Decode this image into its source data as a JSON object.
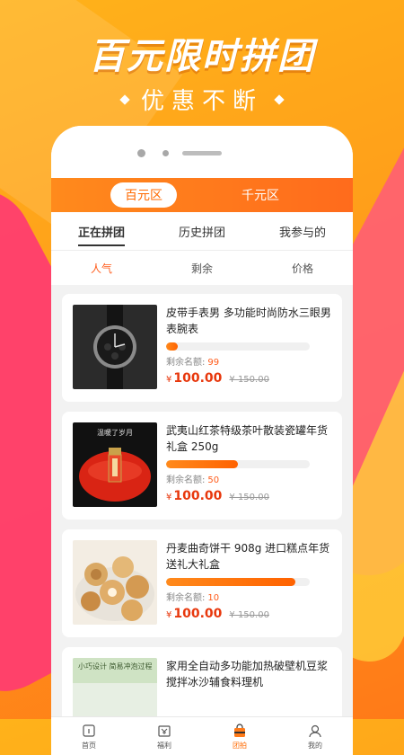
{
  "headline": "百元限时拼团",
  "subline": "优惠不断",
  "zones": [
    "百元区",
    "千元区"
  ],
  "tabs": [
    "正在拼团",
    "历史拼团",
    "我参与的"
  ],
  "sorts": [
    "人气",
    "剩余",
    "价格"
  ],
  "remain_label": "剩余名额:",
  "products": [
    {
      "title": "皮带手表男 多功能时尚防水三眼男表腕表",
      "remain": "99",
      "price": "100.00",
      "old_price": "¥ 150.00",
      "progress": 0.08
    },
    {
      "title": "武夷山红茶特级茶叶散装瓷罐年货礼盒 250g",
      "remain": "50",
      "price": "100.00",
      "old_price": "¥ 150.00",
      "progress": 0.5
    },
    {
      "title": "丹麦曲奇饼干 908g 进口糕点年货送礼大礼盒",
      "remain": "10",
      "price": "100.00",
      "old_price": "¥ 150.00",
      "progress": 0.9
    },
    {
      "title": "家用全自动多功能加热破壁机豆浆搅拌冰沙辅食料理机",
      "remain": "",
      "price": "",
      "old_price": "",
      "progress": 0
    }
  ],
  "thumb_text": {
    "tea": "温暖了岁月",
    "blender": "小巧设计 简易冲泡过程"
  },
  "currency": "¥",
  "nav": [
    "首页",
    "福利",
    "团拍",
    "我的"
  ],
  "colors": {
    "accent": "#ff6a00",
    "price": "#e8380d",
    "bg": "#ff9c1a",
    "pink": "#ff3d6f"
  }
}
